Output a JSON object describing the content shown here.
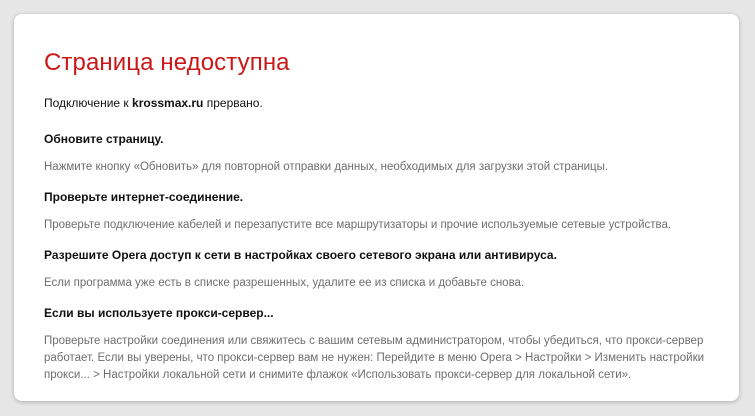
{
  "page": {
    "title": "Страница недоступна",
    "intro_prefix": "Подключение к ",
    "intro_host": "krossmax.ru",
    "intro_suffix": " прервано."
  },
  "sections": [
    {
      "heading": "Обновите страницу.",
      "text": "Нажмите кнопку «Обновить» для повторной отправки данных, необходимых для загрузки этой страницы."
    },
    {
      "heading": "Проверьте интернет-соединение.",
      "text": "Проверьте подключение кабелей и перезапустите все маршрутизаторы и прочие используемые сетевые устройства."
    },
    {
      "heading": "Разрешите Opera доступ к сети в настройках своего сетевого экрана или антивируса.",
      "text": "Если программа уже есть в списке разрешенных, удалите ее из списка и добавьте снова."
    },
    {
      "heading": "Если вы используете прокси-сервер...",
      "text": "Проверьте настройки соединения или свяжитесь с вашим сетевым администратором, чтобы убедиться, что прокси-сервер работает. Если вы уверены, что прокси-сервер вам не нужен: Перейдите в меню Opera > Настройки > Изменить настройки прокси... > Настройки локальной сети и снимите флажок «Использовать прокси-сервер для локальной сети»."
    }
  ],
  "colors": {
    "title": "#cc1717",
    "heading": "#111111",
    "description": "#6e6e6e",
    "background": "#e6e6e6",
    "card": "#ffffff"
  }
}
